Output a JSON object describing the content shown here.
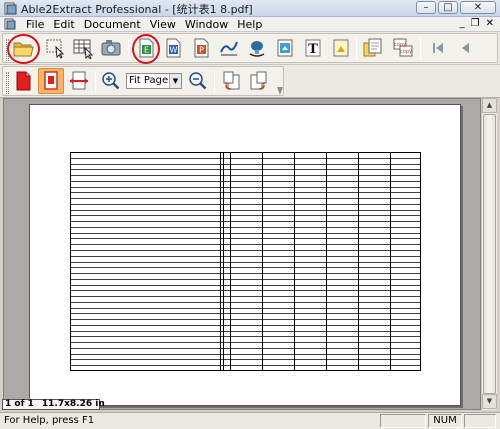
{
  "window": {
    "title": "Able2Extract Professional - [统计表1 8.pdf]",
    "min": "–",
    "max": "□",
    "close": "✕"
  },
  "menu": {
    "items": [
      "File",
      "Edit",
      "Document",
      "View",
      "Window",
      "Help"
    ],
    "mdi_min": "_",
    "mdi_restore": "❐",
    "mdi_close": "✕"
  },
  "toolbar1": {
    "buttons": [
      "open-icon",
      "select-area-icon",
      "select-table-icon",
      "snapshot-icon",
      "excel-icon",
      "word-icon",
      "powerpoint-icon",
      "autocad-icon",
      "publisher-icon",
      "html-icon",
      "text-icon",
      "image-icon",
      "batch-icon",
      "copy-icon",
      "first-page-icon",
      "previous-page-icon"
    ],
    "highlighted": [
      "open-icon",
      "excel-icon"
    ],
    "copy_label": "copy"
  },
  "toolbar2": {
    "buttons": [
      "pdf-icon",
      "fit-page-icon",
      "fit-width-icon",
      "zoom-in-icon",
      "zoom-out-icon",
      "rotate-left-icon",
      "rotate-right-icon"
    ],
    "zoom_value": "Fit Page"
  },
  "document": {
    "page_indicator": "1 of 1",
    "page_size": "11.7x8.26 in",
    "table_columns": 7,
    "table_rows": 38
  },
  "status": {
    "help_text": "For Help, press F1",
    "num": "NUM"
  },
  "colors": {
    "highlight_circle": "#d9121a",
    "active_button": "#f9b36a"
  }
}
